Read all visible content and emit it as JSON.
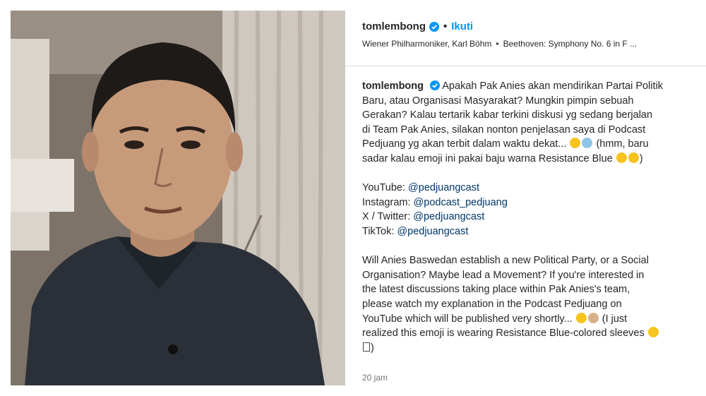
{
  "post": {
    "username": "tomlembong",
    "separator": "•",
    "follow_label": "Ikuti",
    "audio_artist": "Wiener Philharmoniker, Karl Böhm",
    "audio_sep": "•",
    "audio_track": "Beethoven: Symphony No. 6 in F ...",
    "timestamp": "20 jam"
  },
  "caption": {
    "l1": "Apakah Pak Anies akan mendirikan Partai Politik",
    "l2": "Baru, atau Organisasi Masyarakat? Mungkin pimpin sebuah",
    "l3": "Gerakan? Kalau tertarik kabar terkini diskusi yg sedang berjalan",
    "l4": "di Team Pak Anies, silakan nonton penjelasan saya di Podcast",
    "l5a": "Pedjuang yg akan terbit dalam waktu dekat...",
    "l5b": "(hmm, baru",
    "l6": "sadar kalau emoji ini pakai baju warna Resistance Blue",
    "l6end": ")",
    "yt_label": "YouTube:",
    "yt_handle": "@pedjuangcast",
    "ig_label": "Instagram:",
    "ig_handle": "@podcast_pedjuang",
    "x_label": "X / Twitter:",
    "x_handle": "@pedjuangcast",
    "tt_label": "TikTok:",
    "tt_handle": "@pedjuangcast",
    "e1": "Will Anies Baswedan establish a new Political Party, or a Social",
    "e2": "Organisation? Maybe lead a Movement? If you're interested in",
    "e3": "the latest discussions taking place within Pak Anies's team,",
    "e4": "please watch my explanation in the Podcast Pedjuang on",
    "e5a": "YouTube which will be published very shortly...",
    "e5b": "(I just",
    "e6": "realized this emoji is wearing Resistance Blue-colored sleeves",
    "e7": ")"
  },
  "colors": {
    "accent": "#0095f6",
    "mention": "#00376b",
    "muted": "#737373"
  },
  "icons": {
    "verified": "verified-badge-icon",
    "emoji": "emoji-icon"
  }
}
